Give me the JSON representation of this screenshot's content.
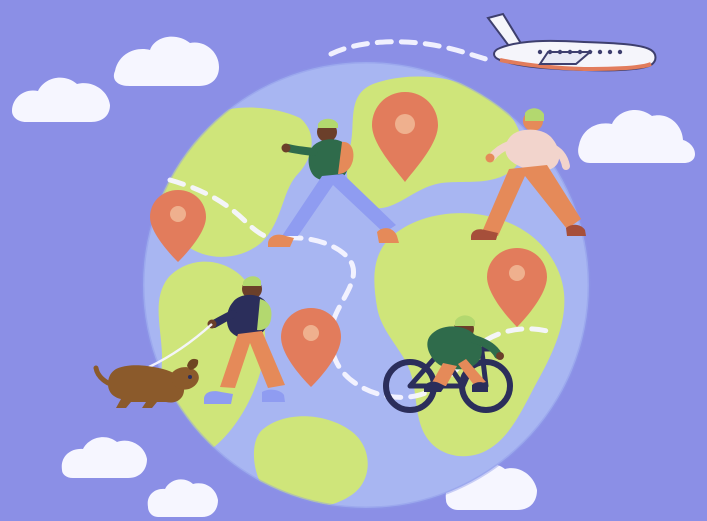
{
  "scene": {
    "icons": [
      "cloud-icon",
      "globe-icon",
      "airplane-icon",
      "location-pin-icon",
      "walking-person-icon",
      "bicycle-icon",
      "dog-icon"
    ],
    "colors": {
      "background": "#8b8fe6",
      "ocean": "#a8b6f2",
      "land": "#cfe57a",
      "pin": "#e27c5c",
      "cloud": "#f6f6ff",
      "skin": "#6b3f2a",
      "jacket_green": "#2f6b4b",
      "jacket_navy": "#2b2e5b",
      "pants_orange": "#e58a59",
      "pants_blue": "#8f9cf1"
    }
  }
}
